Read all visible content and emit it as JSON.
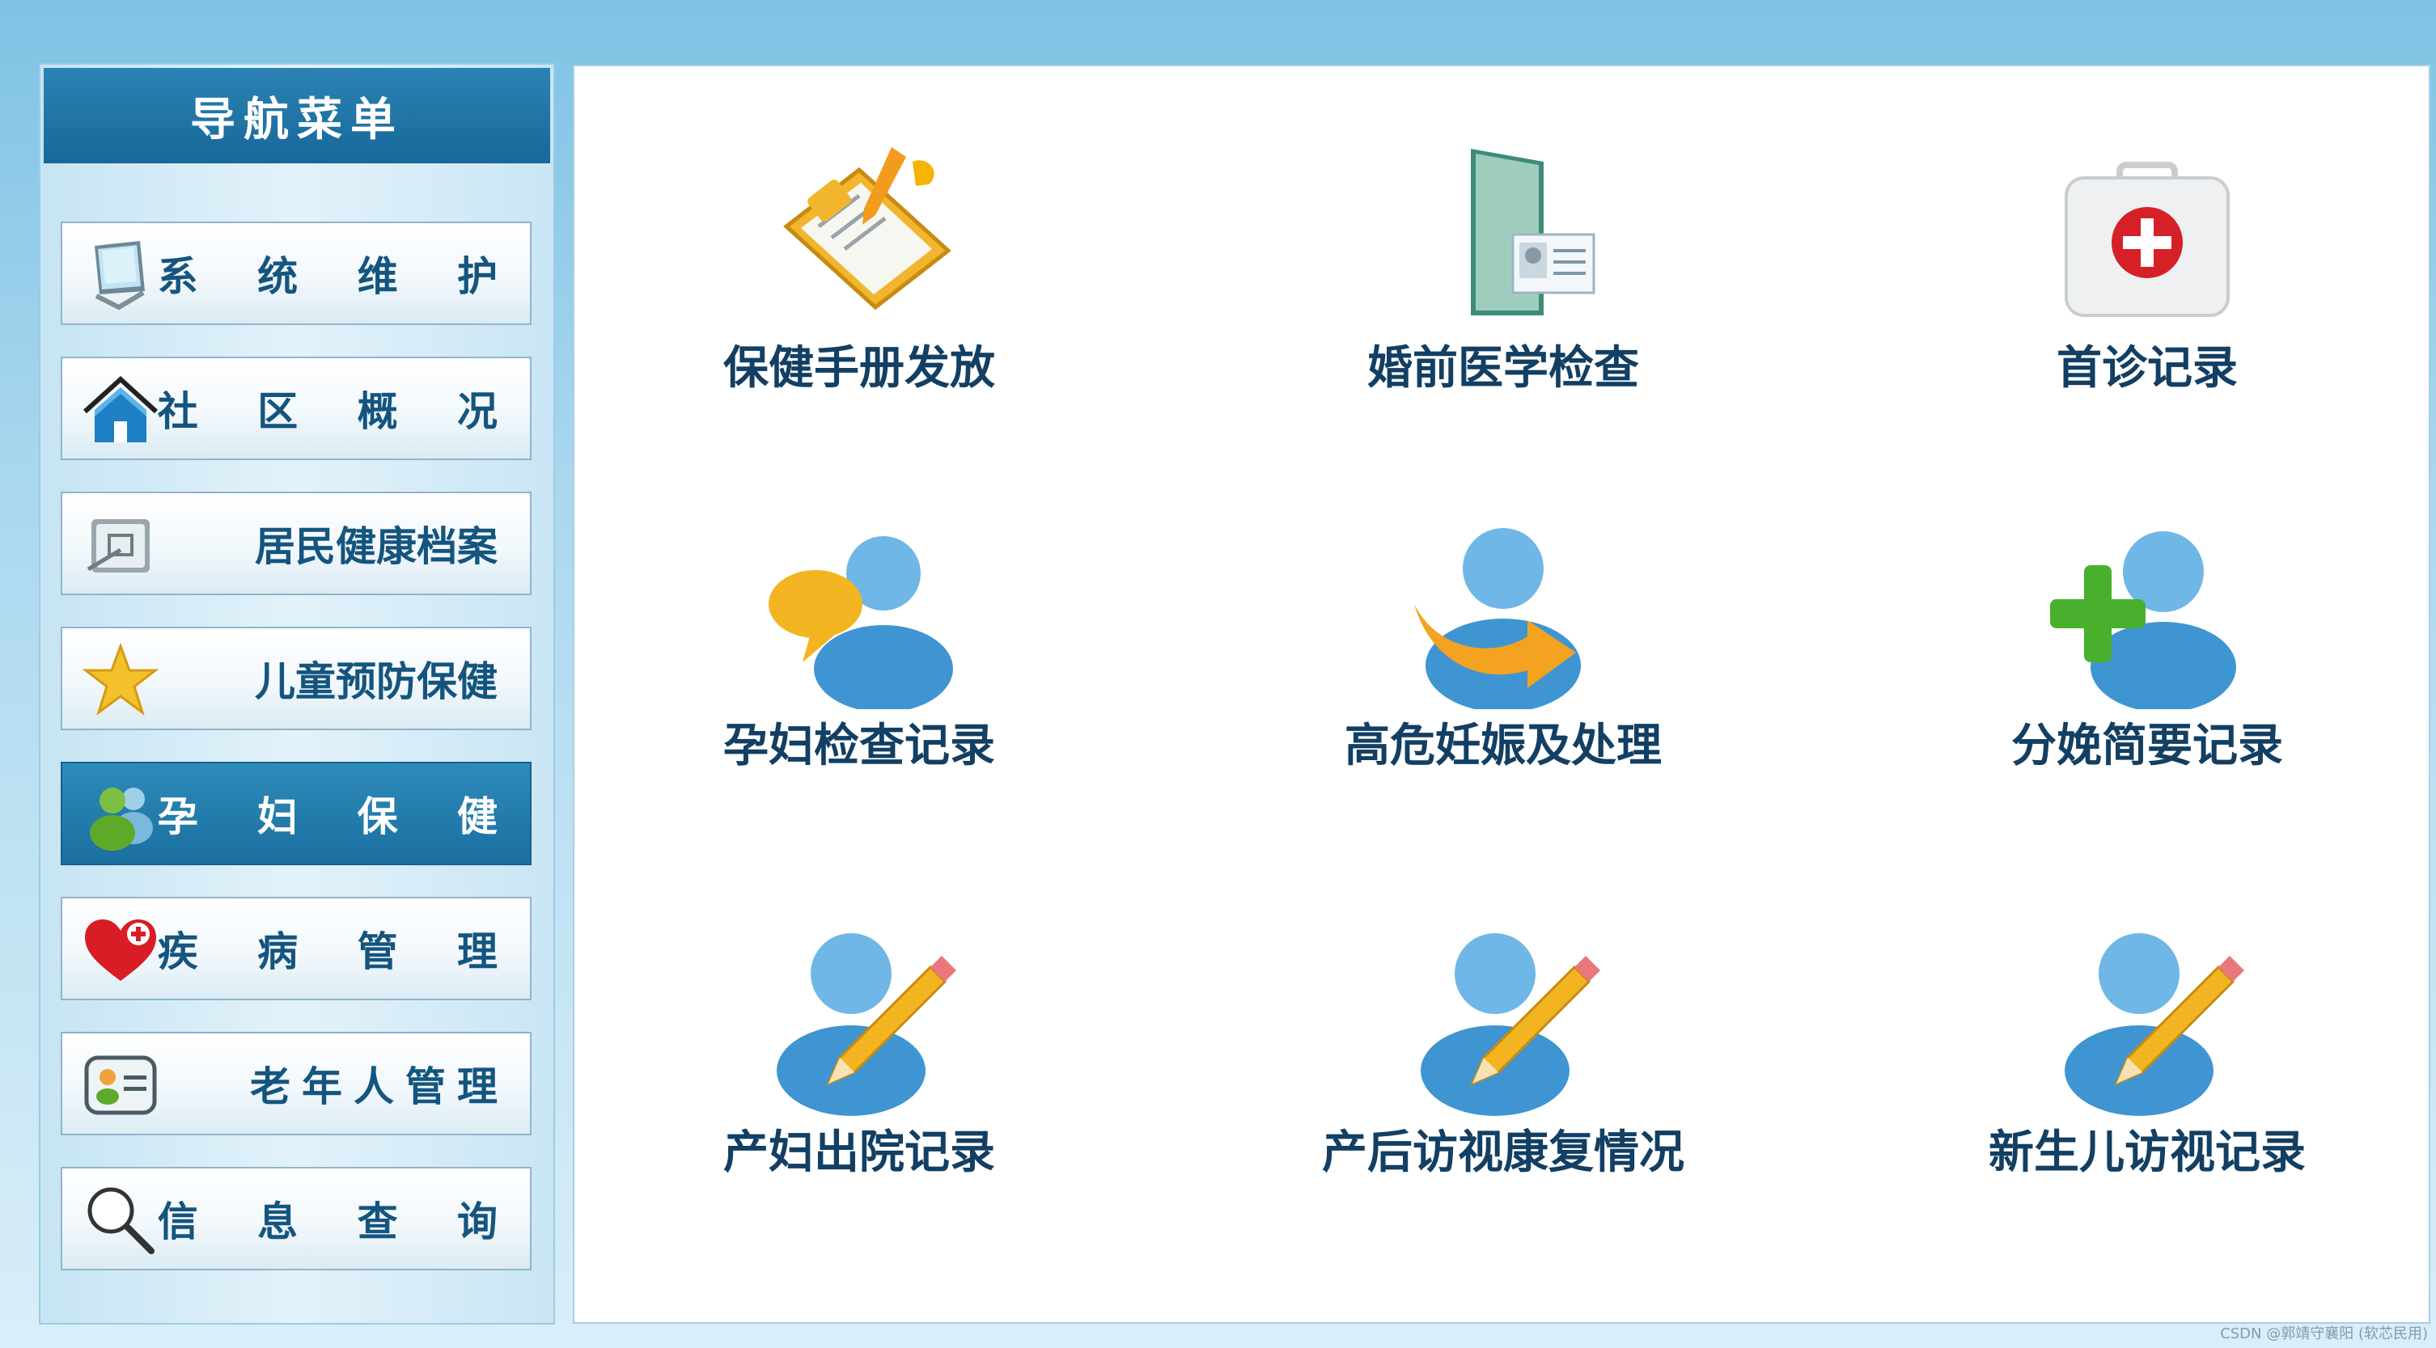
{
  "sidebar": {
    "title": "导航菜单",
    "items": [
      {
        "label": "系 统 维 护",
        "icon": "monitor-icon",
        "active": false
      },
      {
        "label": "社 区 概 况",
        "icon": "home-icon",
        "active": false
      },
      {
        "label": "居民健康档案",
        "icon": "archive-folder-icon",
        "active": false
      },
      {
        "label": "儿童预防保健",
        "icon": "star-icon",
        "active": false
      },
      {
        "label": "孕 妇 保 健",
        "icon": "users-icon",
        "active": true
      },
      {
        "label": "疾 病 管 理",
        "icon": "heart-cross-icon",
        "active": false
      },
      {
        "label": "老年人管理",
        "icon": "contact-card-icon",
        "active": false
      },
      {
        "label": "信 息 查 询",
        "icon": "search-icon",
        "active": false
      }
    ]
  },
  "main": {
    "tiles": [
      {
        "label": "保健手册发放",
        "icon": "clipboard-edit-icon"
      },
      {
        "label": "婚前医学检查",
        "icon": "folder-id-card-icon"
      },
      {
        "label": "首诊记录",
        "icon": "first-aid-kit-icon"
      },
      {
        "label": "孕妇检查记录",
        "icon": "user-chat-icon"
      },
      {
        "label": "高危妊娠及处理",
        "icon": "user-arrow-icon"
      },
      {
        "label": "分娩简要记录",
        "icon": "user-add-icon"
      },
      {
        "label": "产妇出院记录",
        "icon": "user-edit-icon"
      },
      {
        "label": "产后访视康复情况",
        "icon": "user-edit-icon"
      },
      {
        "label": "新生儿访视记录",
        "icon": "user-edit-icon"
      }
    ]
  },
  "watermark": "CSDN @郭靖守襄阳 (软芯民用)",
  "colors": {
    "accent": "#1b6f9f",
    "nav_text": "#14557f",
    "tile_text": "#123f63",
    "background": "#a9d7ee"
  }
}
